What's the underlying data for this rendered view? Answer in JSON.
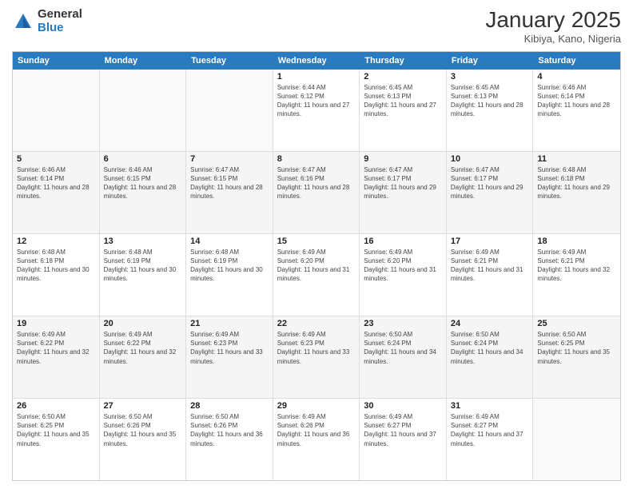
{
  "logo": {
    "general": "General",
    "blue": "Blue"
  },
  "title": "January 2025",
  "subtitle": "Kibiya, Kano, Nigeria",
  "calendar": {
    "headers": [
      "Sunday",
      "Monday",
      "Tuesday",
      "Wednesday",
      "Thursday",
      "Friday",
      "Saturday"
    ],
    "rows": [
      [
        {
          "day": "",
          "info": ""
        },
        {
          "day": "",
          "info": ""
        },
        {
          "day": "",
          "info": ""
        },
        {
          "day": "1",
          "info": "Sunrise: 6:44 AM\nSunset: 6:12 PM\nDaylight: 11 hours and 27 minutes."
        },
        {
          "day": "2",
          "info": "Sunrise: 6:45 AM\nSunset: 6:13 PM\nDaylight: 11 hours and 27 minutes."
        },
        {
          "day": "3",
          "info": "Sunrise: 6:45 AM\nSunset: 6:13 PM\nDaylight: 11 hours and 28 minutes."
        },
        {
          "day": "4",
          "info": "Sunrise: 6:46 AM\nSunset: 6:14 PM\nDaylight: 11 hours and 28 minutes."
        }
      ],
      [
        {
          "day": "5",
          "info": "Sunrise: 6:46 AM\nSunset: 6:14 PM\nDaylight: 11 hours and 28 minutes."
        },
        {
          "day": "6",
          "info": "Sunrise: 6:46 AM\nSunset: 6:15 PM\nDaylight: 11 hours and 28 minutes."
        },
        {
          "day": "7",
          "info": "Sunrise: 6:47 AM\nSunset: 6:15 PM\nDaylight: 11 hours and 28 minutes."
        },
        {
          "day": "8",
          "info": "Sunrise: 6:47 AM\nSunset: 6:16 PM\nDaylight: 11 hours and 28 minutes."
        },
        {
          "day": "9",
          "info": "Sunrise: 6:47 AM\nSunset: 6:17 PM\nDaylight: 11 hours and 29 minutes."
        },
        {
          "day": "10",
          "info": "Sunrise: 6:47 AM\nSunset: 6:17 PM\nDaylight: 11 hours and 29 minutes."
        },
        {
          "day": "11",
          "info": "Sunrise: 6:48 AM\nSunset: 6:18 PM\nDaylight: 11 hours and 29 minutes."
        }
      ],
      [
        {
          "day": "12",
          "info": "Sunrise: 6:48 AM\nSunset: 6:18 PM\nDaylight: 11 hours and 30 minutes."
        },
        {
          "day": "13",
          "info": "Sunrise: 6:48 AM\nSunset: 6:19 PM\nDaylight: 11 hours and 30 minutes."
        },
        {
          "day": "14",
          "info": "Sunrise: 6:48 AM\nSunset: 6:19 PM\nDaylight: 11 hours and 30 minutes."
        },
        {
          "day": "15",
          "info": "Sunrise: 6:49 AM\nSunset: 6:20 PM\nDaylight: 11 hours and 31 minutes."
        },
        {
          "day": "16",
          "info": "Sunrise: 6:49 AM\nSunset: 6:20 PM\nDaylight: 11 hours and 31 minutes."
        },
        {
          "day": "17",
          "info": "Sunrise: 6:49 AM\nSunset: 6:21 PM\nDaylight: 11 hours and 31 minutes."
        },
        {
          "day": "18",
          "info": "Sunrise: 6:49 AM\nSunset: 6:21 PM\nDaylight: 11 hours and 32 minutes."
        }
      ],
      [
        {
          "day": "19",
          "info": "Sunrise: 6:49 AM\nSunset: 6:22 PM\nDaylight: 11 hours and 32 minutes."
        },
        {
          "day": "20",
          "info": "Sunrise: 6:49 AM\nSunset: 6:22 PM\nDaylight: 11 hours and 32 minutes."
        },
        {
          "day": "21",
          "info": "Sunrise: 6:49 AM\nSunset: 6:23 PM\nDaylight: 11 hours and 33 minutes."
        },
        {
          "day": "22",
          "info": "Sunrise: 6:49 AM\nSunset: 6:23 PM\nDaylight: 11 hours and 33 minutes."
        },
        {
          "day": "23",
          "info": "Sunrise: 6:50 AM\nSunset: 6:24 PM\nDaylight: 11 hours and 34 minutes."
        },
        {
          "day": "24",
          "info": "Sunrise: 6:50 AM\nSunset: 6:24 PM\nDaylight: 11 hours and 34 minutes."
        },
        {
          "day": "25",
          "info": "Sunrise: 6:50 AM\nSunset: 6:25 PM\nDaylight: 11 hours and 35 minutes."
        }
      ],
      [
        {
          "day": "26",
          "info": "Sunrise: 6:50 AM\nSunset: 6:25 PM\nDaylight: 11 hours and 35 minutes."
        },
        {
          "day": "27",
          "info": "Sunrise: 6:50 AM\nSunset: 6:26 PM\nDaylight: 11 hours and 35 minutes."
        },
        {
          "day": "28",
          "info": "Sunrise: 6:50 AM\nSunset: 6:26 PM\nDaylight: 11 hours and 36 minutes."
        },
        {
          "day": "29",
          "info": "Sunrise: 6:49 AM\nSunset: 6:26 PM\nDaylight: 11 hours and 36 minutes."
        },
        {
          "day": "30",
          "info": "Sunrise: 6:49 AM\nSunset: 6:27 PM\nDaylight: 11 hours and 37 minutes."
        },
        {
          "day": "31",
          "info": "Sunrise: 6:49 AM\nSunset: 6:27 PM\nDaylight: 11 hours and 37 minutes."
        },
        {
          "day": "",
          "info": ""
        }
      ]
    ]
  }
}
